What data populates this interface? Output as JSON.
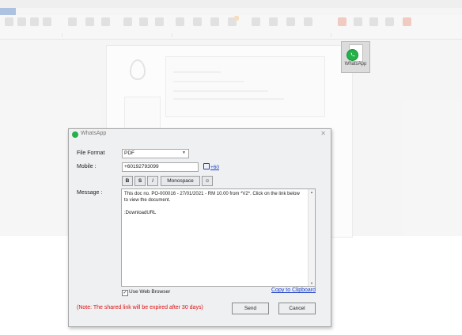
{
  "background": {
    "title_text": "",
    "whatsapp_tile": {
      "label": "WhatsApp",
      "icon": "whatsapp-icon"
    }
  },
  "dialog": {
    "title": "WhatsApp",
    "title_icon": "whatsapp-icon",
    "close_icon": "close-icon",
    "file_format": {
      "label": "File Format",
      "value": "PDF"
    },
    "mobile": {
      "label": "Mobile :",
      "value": "+60192793099",
      "country_code_link": "+60"
    },
    "formatting": {
      "bold": "B",
      "strikethrough": "S",
      "italic": "I",
      "monospace": "Monospace",
      "emoji": "emoji-icon"
    },
    "message": {
      "label": "Message :",
      "text": "This doc no. PO-000016 - 27/01/2021 - RM 10.00 from *V2*. Click on the link below to view the document.\n\n:DownloadURL"
    },
    "use_web_browser": {
      "label": "Use Web Browser",
      "checked": true
    },
    "copy_to_clipboard": "Copy to Clipboard",
    "note": "(Note: The shared link will be expired after 30 days)",
    "send_label": "Send",
    "cancel_label": "Cancel"
  }
}
